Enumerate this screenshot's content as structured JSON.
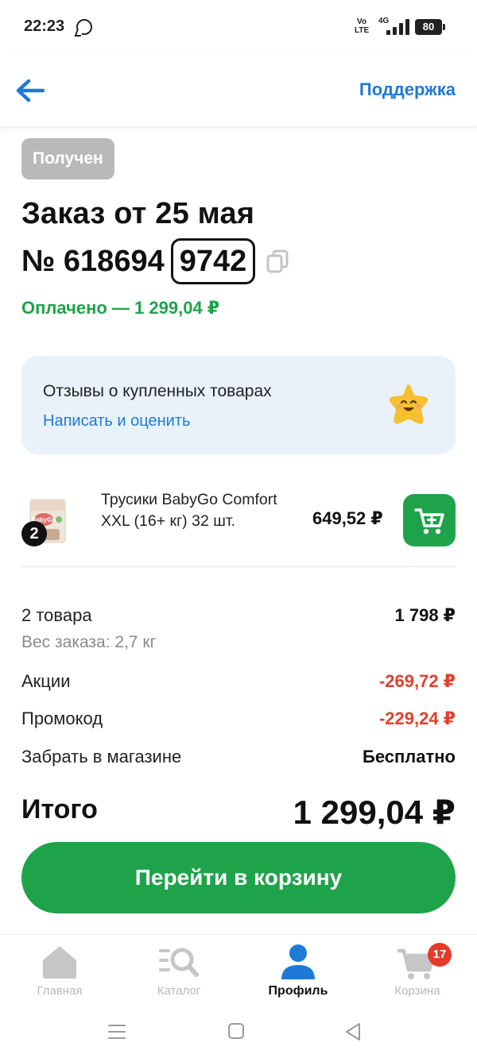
{
  "status_bar": {
    "time": "22:23",
    "volte_top": "Vo",
    "volte_bottom": "LTE",
    "network": "4G",
    "battery": "80"
  },
  "header": {
    "support_label": "Поддержка"
  },
  "order": {
    "status": "Получен",
    "title": "Заказ от 25 мая",
    "number_prefix": "№ 618694",
    "number_suffix": "9742",
    "paid": "Оплачено — 1 299,04 ₽"
  },
  "reviews": {
    "title": "Отзывы о купленных товарах",
    "link": "Написать и оценить"
  },
  "product": {
    "name": "Трусики BabyGo Comfort XXL (16+ кг) 32 шт.",
    "price": "649,52 ₽",
    "quantity": "2",
    "image_brand": "BabyGo"
  },
  "summary": {
    "items_label": "2 товара",
    "items_value": "1 798 ₽",
    "weight": "Вес заказа: 2,7 кг",
    "promo_label": "Акции",
    "promo_value": "-269,72 ₽",
    "promocode_label": "Промокод",
    "promocode_value": "-229,24 ₽",
    "pickup_label": "Забрать в магазине",
    "pickup_value": "Бесплатно",
    "total_label": "Итого",
    "total_value": "1 299,04 ₽"
  },
  "go_cart_label": "Перейти в корзину",
  "nav": {
    "items": [
      {
        "label": "Главная",
        "icon": "home-icon",
        "active": false
      },
      {
        "label": "Каталог",
        "icon": "catalog-search-icon",
        "active": false
      },
      {
        "label": "Профиль",
        "icon": "profile-icon",
        "active": true
      },
      {
        "label": "Корзина",
        "icon": "cart-icon",
        "active": false
      }
    ],
    "cart_count": "17"
  },
  "colors": {
    "accent_blue": "#1e7ad6",
    "green": "#1fa34a",
    "red": "#e0402a",
    "badge_gray": "#b9b9b9"
  }
}
